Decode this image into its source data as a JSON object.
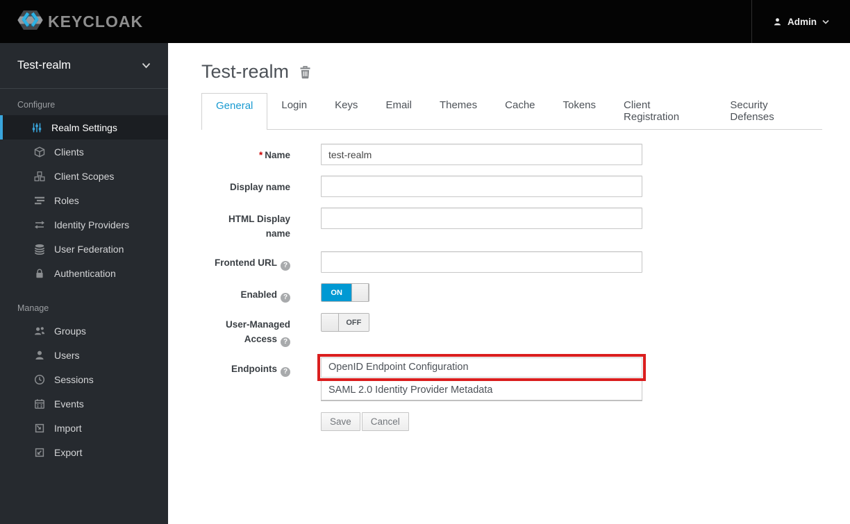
{
  "header": {
    "brand_text": "KEYCLOAK",
    "brand_icon": "keycloak-logo-icon",
    "user_menu": {
      "icon": "user-icon",
      "label": "Admin",
      "caret_icon": "caret-down-icon"
    }
  },
  "sidebar": {
    "realm_selector": {
      "label": "Test-realm",
      "caret_icon": "chevron-down-icon"
    },
    "sections": [
      {
        "label": "Configure",
        "items": [
          {
            "label": "Realm Settings",
            "icon": "sliders-icon",
            "active": true
          },
          {
            "label": "Clients",
            "icon": "cube-icon",
            "active": false
          },
          {
            "label": "Client Scopes",
            "icon": "cubes-icon",
            "active": false
          },
          {
            "label": "Roles",
            "icon": "list-icon",
            "active": false
          },
          {
            "label": "Identity Providers",
            "icon": "exchange-arrows-icon",
            "active": false
          },
          {
            "label": "User Federation",
            "icon": "database-icon",
            "active": false
          },
          {
            "label": "Authentication",
            "icon": "lock-icon",
            "active": false
          }
        ]
      },
      {
        "label": "Manage",
        "items": [
          {
            "label": "Groups",
            "icon": "group-icon",
            "active": false
          },
          {
            "label": "Users",
            "icon": "user-icon",
            "active": false
          },
          {
            "label": "Sessions",
            "icon": "clock-icon",
            "active": false
          },
          {
            "label": "Events",
            "icon": "calendar-icon",
            "active": false
          },
          {
            "label": "Import",
            "icon": "import-icon",
            "active": false
          },
          {
            "label": "Export",
            "icon": "export-icon",
            "active": false
          }
        ]
      }
    ]
  },
  "main": {
    "title": "Test-realm",
    "title_action_icon": "trash-icon",
    "tabs": [
      {
        "label": "General",
        "active": true
      },
      {
        "label": "Login",
        "active": false
      },
      {
        "label": "Keys",
        "active": false
      },
      {
        "label": "Email",
        "active": false
      },
      {
        "label": "Themes",
        "active": false
      },
      {
        "label": "Cache",
        "active": false
      },
      {
        "label": "Tokens",
        "active": false
      },
      {
        "label": "Client Registration",
        "active": false
      },
      {
        "label": "Security Defenses",
        "active": false
      }
    ],
    "form": {
      "required_marker": "*",
      "help_glyph": "?",
      "fields": {
        "name": {
          "label": "Name",
          "value": "test-realm",
          "required": true
        },
        "display_name": {
          "label": "Display name",
          "value": ""
        },
        "html_display_name": {
          "label": "HTML Display name",
          "value": ""
        },
        "frontend_url": {
          "label": "Frontend URL",
          "value": "",
          "has_help": true
        },
        "enabled": {
          "label": "Enabled",
          "has_help": true,
          "state": "ON"
        },
        "user_managed_access": {
          "label": "User-Managed Access",
          "has_help": true,
          "state": "OFF"
        },
        "endpoints": {
          "label": "Endpoints",
          "has_help": true,
          "links": [
            {
              "label": "OpenID Endpoint Configuration",
              "highlighted": true
            },
            {
              "label": "SAML 2.0 Identity Provider Metadata",
              "highlighted": false
            }
          ]
        }
      },
      "buttons": {
        "save": "Save",
        "cancel": "Cancel"
      }
    }
  },
  "colors": {
    "header_bg": "#040404",
    "sidebar_bg": "#262a2f",
    "sidebar_active_accent": "#39a5dc",
    "active_tab_blue": "#189ad1",
    "toggle_on_blue": "#0099d3",
    "highlight_red": "#da1e1e",
    "required_red": "#cc0000"
  }
}
